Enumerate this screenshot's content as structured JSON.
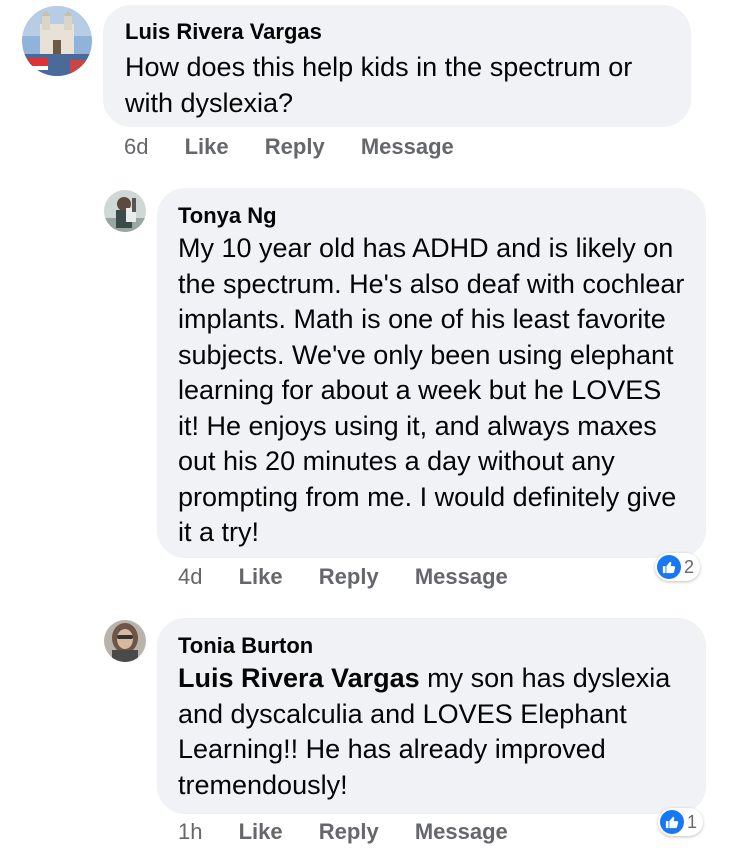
{
  "comments": [
    {
      "author": "Luis Rivera Vargas",
      "text": "How does this help kids in the spectrum or with dyslexia?",
      "time": "6d",
      "like_label": "Like",
      "reply_label": "Reply",
      "message_label": "Message",
      "avatar_icon": "church-photo-avatar"
    },
    {
      "author": "Tonya Ng",
      "text": "My 10 year old has ADHD and is likely on the spectrum. He's also deaf with cochlear implants. Math is one of his least favorite subjects. We've only been using elephant learning for about a week but he LOVES it! He enjoys using it, and always maxes out his 20 minutes a day without any prompting from me. I would definitely give it a try!",
      "time": "4d",
      "like_label": "Like",
      "reply_label": "Reply",
      "message_label": "Message",
      "reaction_count": "2",
      "reaction_icon": "like-icon",
      "avatar_icon": "person-photo-avatar"
    },
    {
      "author": "Tonia Burton",
      "mention": "Luis Rivera Vargas",
      "text": " my son has dyslexia and dyscalculia and LOVES  Elephant Learning!!  He has already improved tremendously!",
      "time": "1h",
      "like_label": "Like",
      "reply_label": "Reply",
      "message_label": "Message",
      "reaction_count": "1",
      "reaction_icon": "like-icon",
      "avatar_icon": "person-photo-avatar"
    }
  ],
  "colors": {
    "bubble": "#f0f2f5",
    "meta_text": "#65676b",
    "like_blue": "#1877f2"
  }
}
